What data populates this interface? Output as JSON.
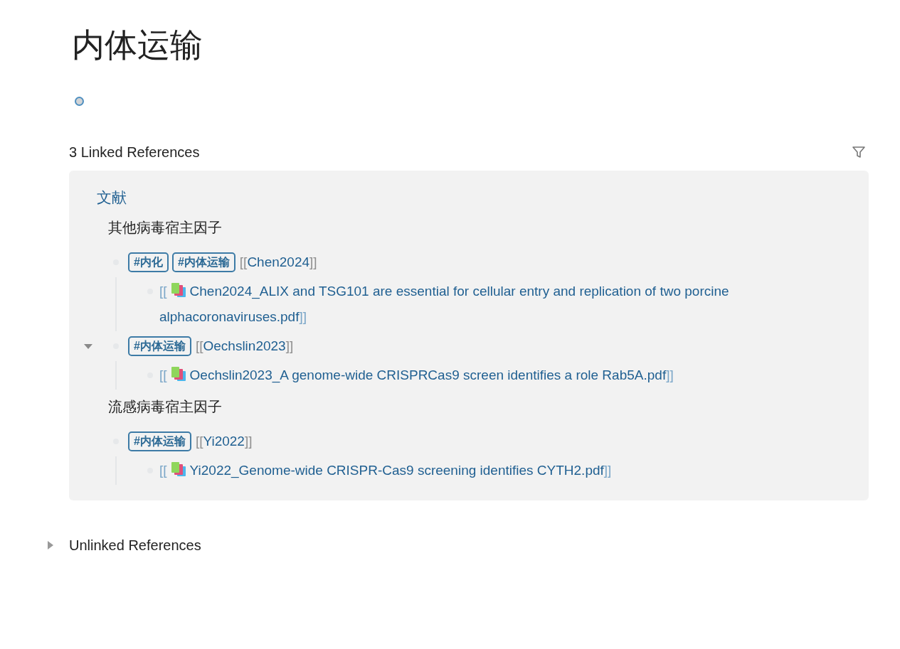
{
  "page": {
    "title": "内体运输"
  },
  "linked_references": {
    "title": "3 Linked References",
    "source_page": "文献",
    "sections": [
      {
        "heading": "其他病毒宿主因子",
        "blocks": [
          {
            "hovered": false,
            "tags": [
              "#内化",
              "#内体运输"
            ],
            "link": {
              "open": "[[",
              "text": "Chen2024",
              "close": "]]"
            },
            "children": [
              {
                "open": "[[",
                "text": "Chen2024_ALIX and TSG101 are essential for cellular entry and replication of two porcine alphacoronaviruses.pdf",
                "close": "]]"
              }
            ]
          },
          {
            "hovered": true,
            "tags": [
              "#内体运输"
            ],
            "link": {
              "open": "[[",
              "text": "Oechslin2023",
              "close": "]]"
            },
            "children": [
              {
                "open": "[[",
                "text": "Oechslin2023_A genome-wide CRISPRCas9 screen identifies a role Rab5A.pdf",
                "close": "]]"
              }
            ]
          }
        ]
      },
      {
        "heading": "流感病毒宿主因子",
        "blocks": [
          {
            "hovered": false,
            "tags": [
              "#内体运输"
            ],
            "link": {
              "open": "[[",
              "text": "Yi2022",
              "close": "]]"
            },
            "children": [
              {
                "open": "[[",
                "text": "Yi2022_Genome-wide CRISPR-Cas9 screening identifies CYTH2.pdf",
                "close": "]]"
              }
            ]
          }
        ]
      }
    ]
  },
  "unlinked_references": {
    "title": "Unlinked References",
    "expanded": false
  }
}
